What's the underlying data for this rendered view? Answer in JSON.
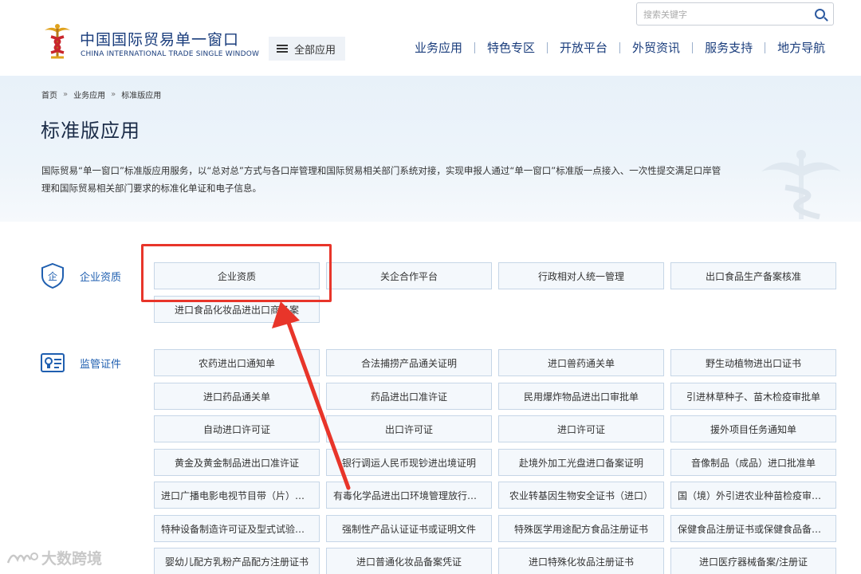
{
  "header": {
    "logo_cn": "中国国际贸易单一窗口",
    "logo_en": "CHINA INTERNATIONAL TRADE SINGLE WINDOW",
    "all_apps_label": "全部应用",
    "search_placeholder": "搜索关键字",
    "nav": [
      "业务应用",
      "特色专区",
      "开放平台",
      "外贸资讯",
      "服务支持",
      "地方导航"
    ]
  },
  "breadcrumb": [
    "首页",
    "业务应用",
    "标准版应用"
  ],
  "page_title": "标准版应用",
  "description": "国际贸易“单一窗口”标准版应用服务，以“总对总”方式与各口岸管理和国际贸易相关部门系统对接，实现申报人通过“单一窗口”标准版一点接入、一次性提交满足口岸管理和国际贸易相关部门要求的标准化单证和电子信息。",
  "categories": [
    {
      "label": "企业资质",
      "icon": "enterprise-shield-icon",
      "items": [
        "企业资质",
        "关企合作平台",
        "行政相对人统一管理",
        "出口食品生产备案核准",
        "进口食品化妆品进出口商备案"
      ]
    },
    {
      "label": "监管证件",
      "icon": "certificate-card-icon",
      "items": [
        "农药进出口通知单",
        "合法捕捞产品通关证明",
        "进口兽药通关单",
        "野生动植物进出口证书",
        "进口药品通关单",
        "药品进出口准许证",
        "民用爆炸物品进出口审批单",
        "引进林草种子、苗木检疫审批单",
        "自动进口许可证",
        "出口许可证",
        "进口许可证",
        "援外项目任务通知单",
        "黄金及黄金制品进出口准许证",
        "银行调运人民币现钞进出境证明",
        "赴境外加工光盘进口备案证明",
        "音像制品（成品）进口批准单",
        "进口广播电影电视节目带（片）提取单",
        "有毒化学品进出口环境管理放行通知单",
        "农业转基因生物安全证书（进口）",
        "国（境）外引进农业种苗检疫审批单",
        "特种设备制造许可证及型式试验证书",
        "强制性产品认证证书或证明文件",
        "特殊医学用途配方食品注册证书",
        "保健食品注册证书或保健食品备案凭证",
        "婴幼儿配方乳粉产品配方注册证书",
        "进口普通化妆品备案凭证",
        "进口特殊化妆品注册证书",
        "进口医疗器械备案/注册证"
      ]
    }
  ],
  "watermark": "大数跨境",
  "colors": {
    "brand": "#1a3d7c",
    "accent": "#1f5fb0",
    "highlight": "#e8352a"
  }
}
